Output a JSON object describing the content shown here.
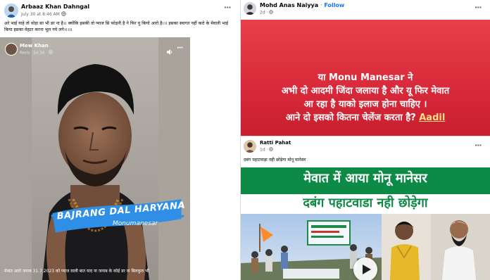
{
  "post1": {
    "author": "Arbaaz Khan Dahngal",
    "timestamp": "July 30 at 8:46 AM",
    "privacy_icon": "globe-icon",
    "text": "अरे भाई याहे तो थोड़ा सा भी डर ना है।। क्योंकि इसकी तो प्याज सि फोड़नी है ने फिर यु कियो आरो है।।। इसका स्वागत नहीं करो के मेवाती भाई किया इसका वेहटर करना भूल गये लगे।।।।।",
    "menu_icon": "more-horizontal-icon",
    "reel": {
      "author": "Mew Khan",
      "source": "Reels · Jul 30 ·",
      "privacy_icon": "globe-icon",
      "mute_icon": "speaker-icon",
      "menu_icon": "more-horizontal-icon",
      "banner_main": "BAJRANG DAL HARYANA",
      "banner_sub": "Monumanesar",
      "caption": "मेवात आरो जनाब 31.7.2023 को प्याज वाली बात याद ना जनाब के कोई डर ना बिलकुल भी"
    }
  },
  "post2": {
    "author": "Mohd Anas Naiyya",
    "separator": "·",
    "follow": "Follow",
    "timestamp": "2d ·",
    "privacy_icon": "globe-icon",
    "menu_icon": "more-horizontal-icon",
    "lines": [
      "या Monu Manesar ने",
      "अभी दो आदमी जिंदा जलाया है और यू फिर मेवात",
      "आ रहा है याको इलाज होना चाहिए ।",
      "आने दो इसको कितना चेलेंज करता है?"
    ],
    "signature": "Aadil"
  },
  "post3": {
    "author": "Ratti Pahat",
    "timestamp": "1d ·",
    "privacy_icon": "globe-icon",
    "menu_icon": "more-horizontal-icon",
    "text": "दबंग पहाटवाड़ा नही छोड़ेगा मोनू मानेसर",
    "headline1": "मेवात में आया मोनू मानेसर",
    "headline2": "दबंग पहाटवाडा नही छोड़ेगा",
    "play_icon": "play-icon"
  },
  "colors": {
    "red_gradient_top": "#e8414a",
    "red_gradient_bottom": "#c81e2e",
    "headline_green": "#0e8a47",
    "banner_blue": "#2f8fe6",
    "link_blue": "#1877f2"
  }
}
